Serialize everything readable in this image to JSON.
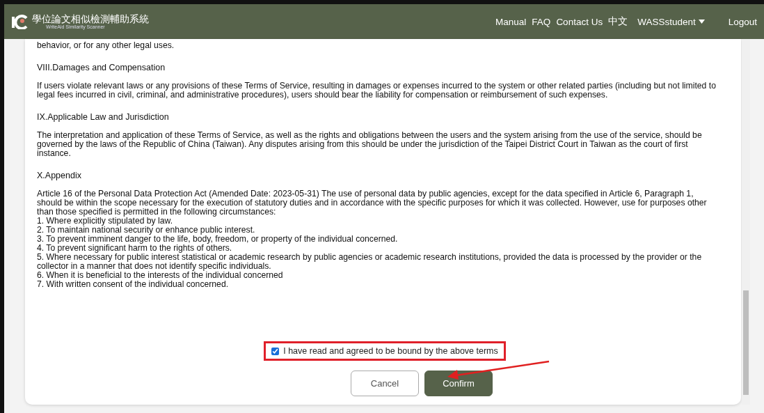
{
  "header": {
    "title": "學位論文相似檢測輔助系統",
    "subtitle": "WriteAid Similarity Scanner",
    "nav": [
      "Manual",
      "FAQ",
      "Contact Us",
      "中文"
    ],
    "user": "WASSstudent",
    "logout": "Logout"
  },
  "terms": {
    "cut_line": "behavior, or for any other legal uses.",
    "sections": [
      {
        "heading": "VIII.Damages and Compensation",
        "paragraph": "If users violate relevant laws or any provisions of these Terms of Service, resulting in damages or expenses incurred to the system or other related parties (including but not limited to legal fees incurred in civil, criminal, and administrative procedures), users should bear the liability for compensation or reimbursement of such expenses."
      },
      {
        "heading": "IX.Applicable Law and Jurisdiction",
        "paragraph": "The interpretation and application of these Terms of Service, as well as the rights and obligations between the users and the system arising from the use of the service, should be governed by the laws of the Republic of China (Taiwan). Any disputes arising from this should be under the jurisdiction of the Taipei District Court in Taiwan as the court of first instance."
      },
      {
        "heading": "X.Appendix",
        "paragraph": "Article 16 of the Personal Data Protection Act (Amended Date: 2023-05-31) The use of personal data by public agencies, except for the data specified in Article 6, Paragraph 1, should be within the scope necessary for the execution of statutory duties and in accordance with the specific purposes for which it was collected. However, use for purposes other than those specified is permitted in the following circumstances:",
        "items": [
          "1. Where explicitly stipulated by law.",
          "2. To maintain national security or enhance public interest.",
          "3. To prevent imminent danger to the life, body, freedom, or property of the individual concerned.",
          "4. To prevent significant harm to the rights of others.",
          "5. Where necessary for public interest statistical or academic research by public agencies or academic research institutions, provided the data is processed by the provider or the collector in a manner that does not identify specific individuals.",
          "6. When it is beneficial to the interests of the individual concerned",
          "7. With written consent of the individual concerned."
        ]
      }
    ]
  },
  "agree": {
    "label": "I have read and agreed to be bound by the above terms",
    "checked": true
  },
  "buttons": {
    "cancel": "Cancel",
    "confirm": "Confirm"
  }
}
